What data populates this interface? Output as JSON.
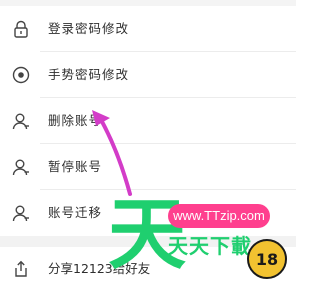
{
  "menu": {
    "items": [
      {
        "label": "登录密码修改",
        "icon": "lock-icon"
      },
      {
        "label": "手势密码修改",
        "icon": "gesture-dot-icon"
      },
      {
        "label": "删除账号",
        "icon": "user-icon"
      },
      {
        "label": "暂停账号",
        "icon": "user-icon"
      },
      {
        "label": "账号迁移",
        "icon": "user-icon"
      }
    ],
    "share_label": "分享12123给好友",
    "share_icon": "share-icon"
  },
  "watermark": {
    "glyph": "天",
    "url": "www.TTzip.com",
    "name": "天天下載",
    "badge_text": "18",
    "colors": {
      "green": "#1fcf6f",
      "pink": "#ff3f8e",
      "gold": "#f2c230"
    }
  },
  "annotation": {
    "arrow_color": "#d33cc8",
    "points_to": "删除账号"
  }
}
